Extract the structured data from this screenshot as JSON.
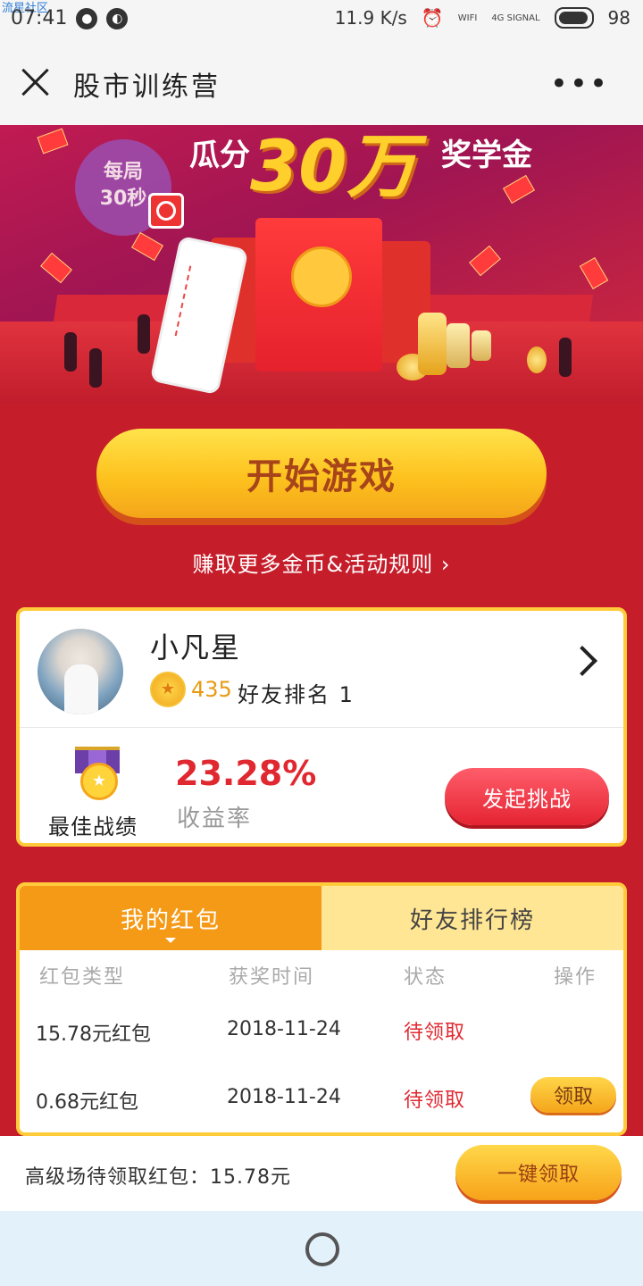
{
  "status_bar": {
    "watermark": "流星社区",
    "time": "07:41",
    "speed": "11.9 K/s",
    "wifi_label": "WIFI",
    "signal_label": "4G SIGNAL",
    "battery": "98"
  },
  "nav": {
    "title": "股市训练营"
  },
  "banner": {
    "timer_line1": "每局",
    "timer_line2": "30秒",
    "title_part1": "瓜分",
    "title_part2": "30万",
    "title_part3": "奖学金"
  },
  "actions": {
    "start_game": "开始游戏",
    "rules_link": "赚取更多金币&活动规则 ›"
  },
  "profile": {
    "name": "小凡星",
    "coins": "435",
    "friend_rank": "好友排名 1",
    "best_label": "最佳战绩",
    "yield_value": "23.28%",
    "yield_label": "收益率",
    "challenge_button": "发起挑战"
  },
  "redpacket_panel": {
    "tabs": [
      "我的红包",
      "好友排行榜"
    ],
    "headers": [
      "红包类型",
      "获奖时间",
      "状态",
      "操作"
    ],
    "rows": [
      {
        "type": "15.78元红包",
        "date": "2018-11-24",
        "status": "待领取",
        "action": ""
      },
      {
        "type": "0.68元红包",
        "date": "2018-11-24",
        "status": "待领取",
        "action": "领取"
      }
    ]
  },
  "footer": {
    "pending_text": "高级场待领取红包：15.78元",
    "claim_all": "一键领取"
  },
  "colors": {
    "page_bg": "#c61d2a",
    "accent_yellow": "#fdc21e",
    "accent_orange": "#f59a16",
    "status_red": "#e02830"
  }
}
